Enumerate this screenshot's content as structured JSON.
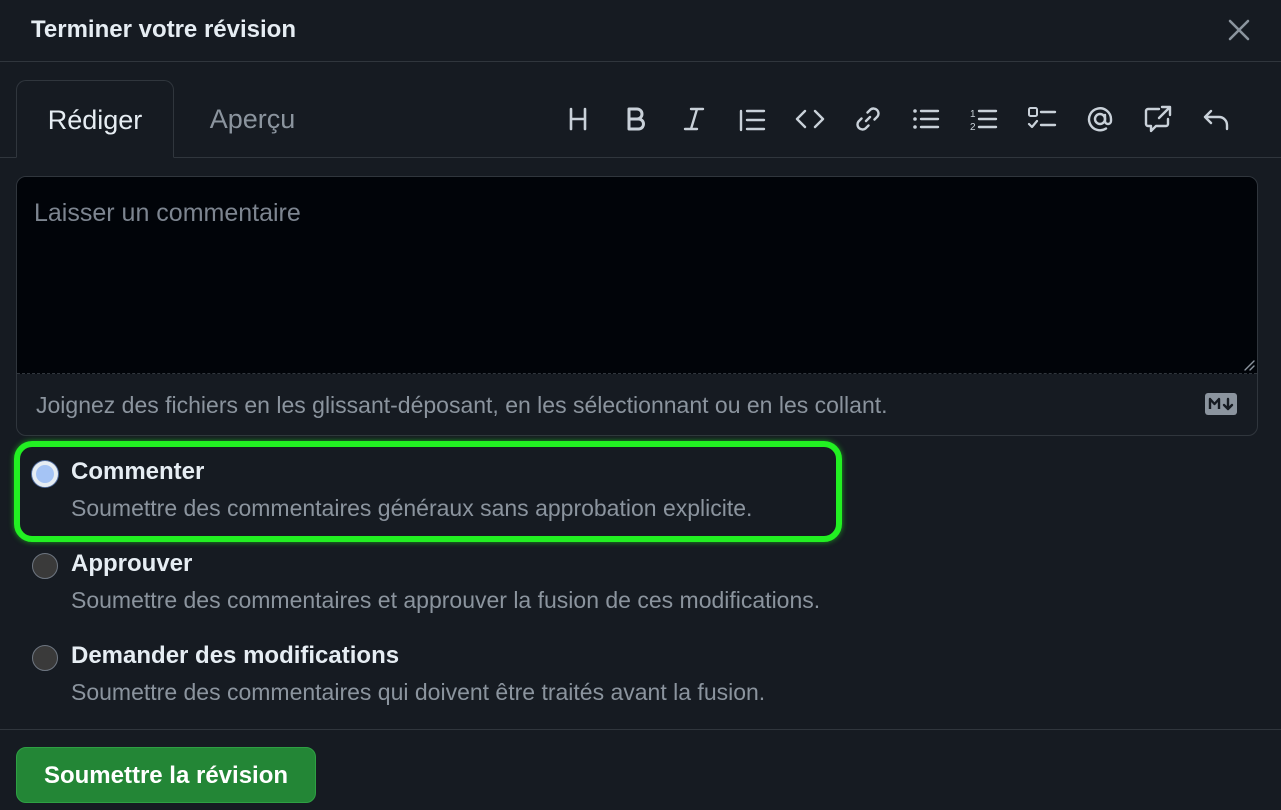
{
  "dialog": {
    "title": "Terminer votre révision",
    "close_icon": "close-icon"
  },
  "tabs": [
    {
      "label": "Rédiger",
      "active": true
    },
    {
      "label": "Aperçu",
      "active": false
    }
  ],
  "toolbar": [
    {
      "name": "heading-icon",
      "glyph": "H"
    },
    {
      "name": "bold-icon",
      "glyph": "B"
    },
    {
      "name": "italic-icon",
      "glyph": "I"
    },
    {
      "name": "quote-icon"
    },
    {
      "name": "code-icon"
    },
    {
      "name": "link-icon"
    },
    {
      "name": "unordered-list-icon"
    },
    {
      "name": "ordered-list-icon"
    },
    {
      "name": "task-list-icon"
    },
    {
      "name": "mention-icon"
    },
    {
      "name": "cross-reference-icon"
    },
    {
      "name": "undo-icon"
    }
  ],
  "editor": {
    "placeholder": "Laisser un commentaire",
    "value": "",
    "attach_text": "Joignez des fichiers en les glissant-déposant, en les sélectionnant ou en les collant.",
    "markdown_icon": "markdown-icon"
  },
  "options": [
    {
      "title": "Commenter",
      "description": "Soumettre des commentaires généraux sans approbation explicite.",
      "checked": true
    },
    {
      "title": "Approuver",
      "description": "Soumettre des commentaires et approuver la fusion de ces modifications.",
      "checked": false
    },
    {
      "title": "Demander des modifications",
      "description": "Soumettre des commentaires qui doivent être traités avant la fusion.",
      "checked": false
    }
  ],
  "submit": {
    "label": "Soumettre la révision"
  },
  "colors": {
    "background": "#161b22",
    "editor_bg": "#010409",
    "border": "#30363d",
    "text": "#e6edf3",
    "muted": "#8b949e",
    "submit_bg": "#238636",
    "highlight": "#22f022",
    "radio_checked": "#a5c4f5"
  }
}
